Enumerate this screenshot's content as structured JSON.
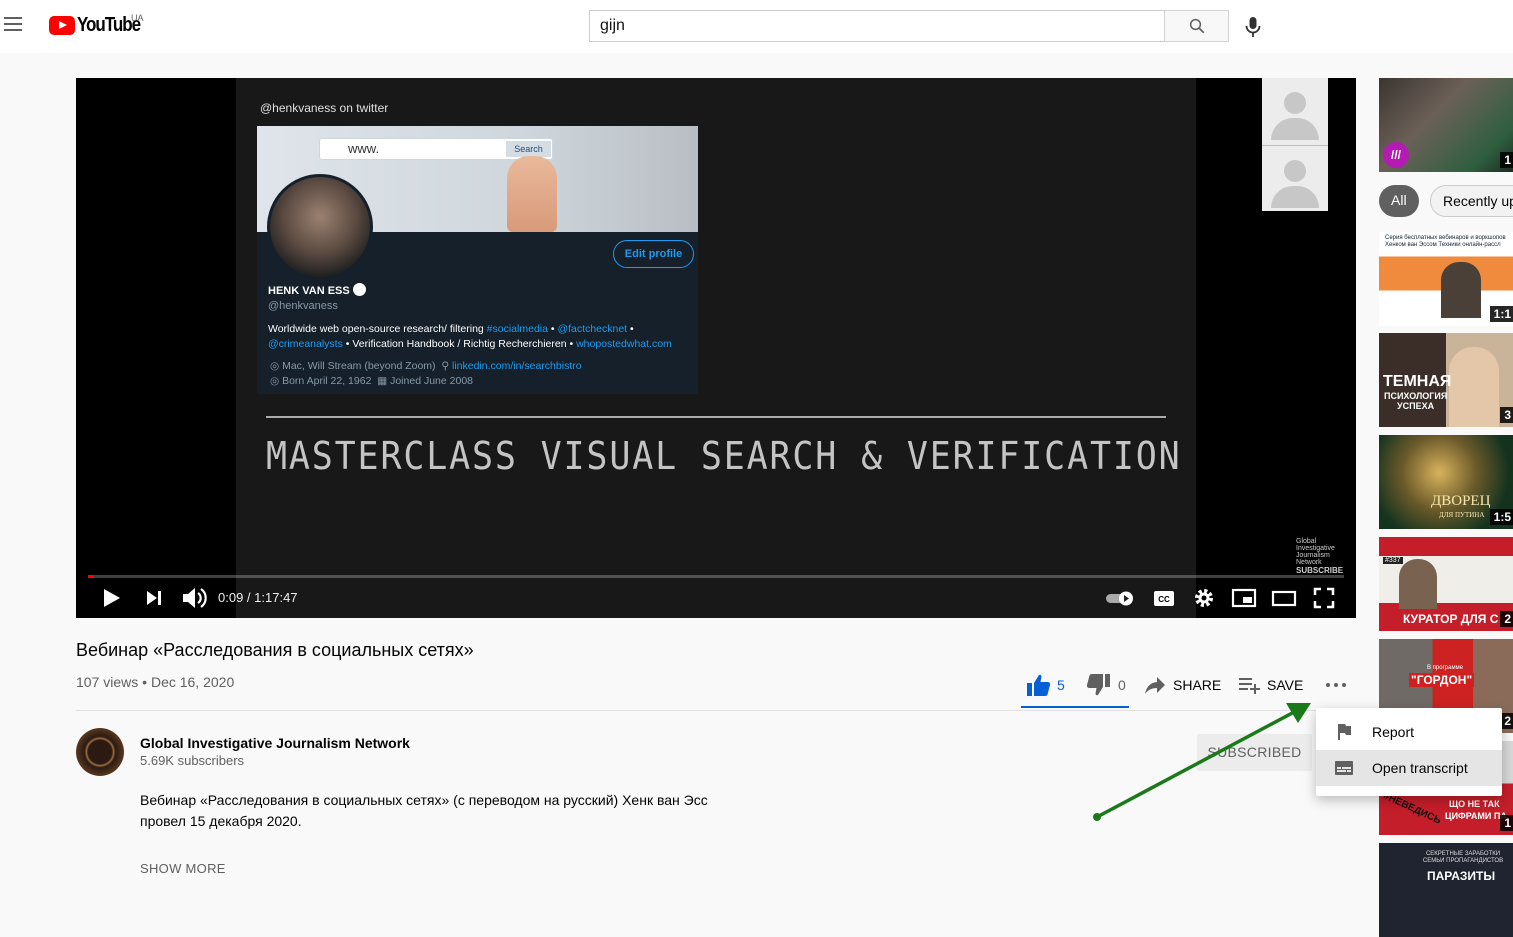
{
  "masthead": {
    "logo_text": "YouTube",
    "country_code": "UA",
    "search_value": "gijn"
  },
  "player": {
    "slide": {
      "handle": "@henkvaness on twitter",
      "search_prefix": "www.",
      "search_button": "Search",
      "edit_profile": "Edit profile",
      "name": "HENK VAN ESS",
      "username": "@henkvaness",
      "bio_line1_pre": "Worldwide web open-source research/ filtering ",
      "bio_tag1": "#socialmedia",
      "bio_dot1": " • ",
      "bio_tag2": "@factchecknet",
      "bio_dot2": " •",
      "bio_tag3": "@crimeanalysts",
      "bio_line2_mid": " • Verification Handbook / Richtig Recherchieren • ",
      "bio_tag4": "whopostedwhat.com",
      "meta_location": "Mac, Will Stream (beyond Zoom)",
      "meta_link": "linkedin.com/in/searchbistro",
      "meta_born": "Born April 22, 1962",
      "meta_joined": "Joined June 2008",
      "masterclass": "MASTERCLASS VISUAL SEARCH & VERIFICATION",
      "watermark_line1": "Global Investigative",
      "watermark_line2": "Journalism Network",
      "watermark_sub": "SUBSCRIBE"
    },
    "current_time": "0:09",
    "duration": "1:17:47",
    "time_separator": " / ",
    "progress_fraction": 0.0019
  },
  "video": {
    "title": "Вебинар «Расследования в социальных сетях»",
    "views": "107 views",
    "date_sep": " • ",
    "date": "Dec 16, 2020",
    "like_count": "5",
    "dislike_count": "0",
    "share_label": "SHARE",
    "save_label": "SAVE"
  },
  "channel": {
    "name": "Global Investigative Journalism Network",
    "subscribers": "5.69K subscribers",
    "subscribe_state": "SUBSCRIBED",
    "description_line1": "Вебинар «Расследования в социальных сетях» (с переводом на русский) Хенк ван Эсс",
    "description_line2": "провел 15 декабря 2020.",
    "show_more": "SHOW MORE"
  },
  "menu": {
    "items": [
      {
        "label": "Report",
        "icon": "flag-icon"
      },
      {
        "label": "Open transcript",
        "icon": "transcript-icon"
      }
    ]
  },
  "sidebar": {
    "chips": [
      "All",
      "Recently up"
    ],
    "thumbnails": [
      {
        "duration": "1"
      },
      {
        "overlay_top": "Серия бесплатных вебинаров и воркшопов Хенком ван Эссом Техники онлайн-рассл",
        "duration": "1:1"
      },
      {
        "overlay": "ТЕМНАЯ",
        "overlay2": "ПСИХОЛОГИЯ",
        "overlay3": "УСПЕХА",
        "duration": "3"
      },
      {
        "overlay": "ДВОРЕЦ",
        "overlay2": "ДЛЯ ПУТИНА",
        "duration": "1:5"
      },
      {
        "overlay": "КУРАТОР ДЛЯ С",
        "badge": "#337",
        "duration": "2"
      },
      {
        "overlay": "\"ГОРДОН\"",
        "overlay_top": "В программе",
        "duration": "2"
      },
      {
        "overlay": "ЩО НЕ ТАК",
        "overlay2": "ЦИФРАМИ ПА",
        "tag": "#НЕВЕДИСЬ",
        "duration": "1"
      },
      {
        "overlay_top": "СЕКРЕТНЫЕ ЗАРАБОТКИ СЕМЬИ ПРОПАГАНДИСТОВ",
        "overlay": "ПАРАЗИТЫ"
      }
    ]
  },
  "colors": {
    "accent_blue": "#065fd4",
    "youtube_red": "#ff0000",
    "annotation_arrow": "#1a7a1a",
    "twitter_blue": "#1d9bf0"
  }
}
